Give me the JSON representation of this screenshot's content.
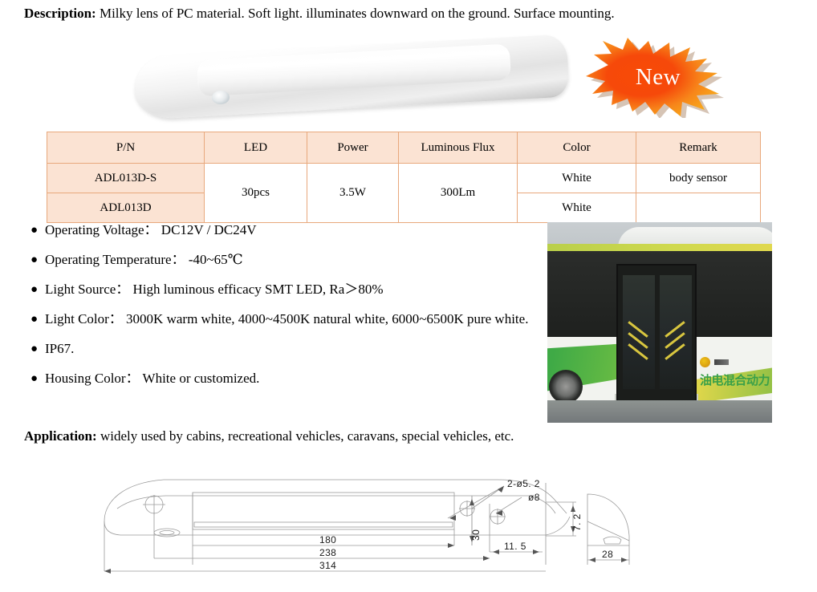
{
  "description": {
    "lead": "Description:",
    "text": "Milky lens of PC material. Soft light. illuminates downward on the ground. Surface mounting."
  },
  "badge": {
    "label": "New",
    "fill_outer": "#F5A623",
    "fill_inner": "#F43A05",
    "text_color": "#FFFFFF"
  },
  "product_photo": {
    "alt": "white LED bar light with milky lens and body sensor dome"
  },
  "table": {
    "accent_border": "#E8A87C",
    "header_fill": "#FBE3D3",
    "headers": [
      "P/N",
      "LED",
      "Power",
      "Luminous Flux",
      "Color",
      "Remark"
    ],
    "rows": [
      {
        "pn": "ADL013D-S",
        "led": "30pcs",
        "power": "3.5W",
        "luminous_flux": "300Lm",
        "color": "White",
        "remark": "body sensor"
      },
      {
        "pn": "ADL013D",
        "led": "30pcs",
        "power": "3.5W",
        "luminous_flux": "300Lm",
        "color": "White",
        "remark": ""
      }
    ]
  },
  "bullets": [
    {
      "dot": "●",
      "text": "Operating Voltage： DC12V / DC24V"
    },
    {
      "dot": "●",
      "text": "Operating Temperature： -40~65℃"
    },
    {
      "dot": "●",
      "text": "Light Source： High luminous efficacy SMT LED, Ra＞80%"
    },
    {
      "dot": "●",
      "text": "Light Color： 3000K warm white, 4000~4500K natural white, 6000~6500K pure white."
    },
    {
      "dot": "●",
      "text": "IP67."
    },
    {
      "dot": "●",
      "text": "Housing Color： White or customized."
    }
  ],
  "application": {
    "lead": "Application:",
    "text": "widely used by cabins, recreational vehicles, caravans, special vehicles, etc."
  },
  "bus_photo": {
    "alt": "green and yellow hybrid city bus with open double doors",
    "marking": "油电混合动力"
  },
  "tech_drawing": {
    "dimensions": {
      "length_lens": "180",
      "length_mid": "238",
      "length_total": "314",
      "height_30": "30",
      "hole_callout": "2-ø5. 2",
      "hole_dia": "ø8",
      "offset_11_5": "11. 5",
      "height_7_2": "7. 2",
      "width_28": "28"
    },
    "line_color": "#9a9a9a"
  }
}
